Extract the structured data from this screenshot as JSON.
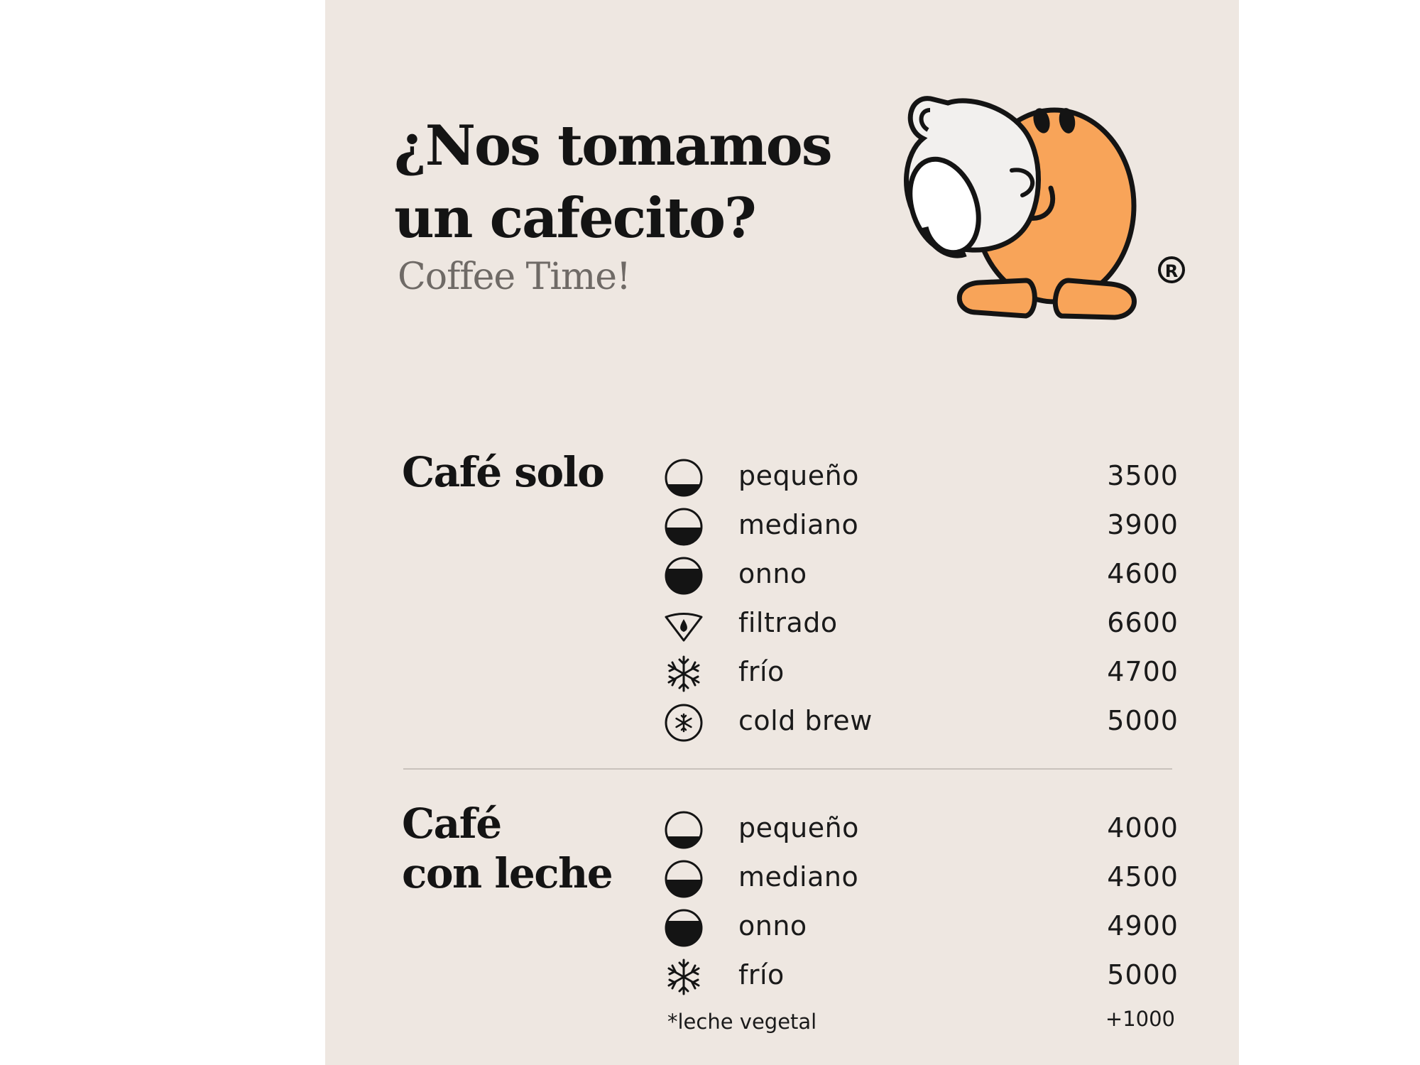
{
  "header": {
    "title_line1": "¿Nos tomamos",
    "title_line2": "un cafecito?",
    "subtitle": "Coffee Time!"
  },
  "mascot": {
    "icon": "mascot-holding-cup",
    "registered_mark": "®",
    "body_color": "#F8A459"
  },
  "colors": {
    "background": "#EEE7E1",
    "text": "#141414",
    "subtitle": "#6F6A66",
    "divider": "#C9C2BC"
  },
  "sections": [
    {
      "title_line1": "Café solo",
      "title_line2": "",
      "items": [
        {
          "icon": "cup-fill-small-icon",
          "name": "pequeño",
          "price": "3500"
        },
        {
          "icon": "cup-fill-medium-icon",
          "name": "mediano",
          "price": "3900"
        },
        {
          "icon": "cup-fill-large-icon",
          "name": "onno",
          "price": "4600"
        },
        {
          "icon": "filter-drop-icon",
          "name": "filtrado",
          "price": "6600"
        },
        {
          "icon": "snowflake-icon",
          "name": "frío",
          "price": "4700"
        },
        {
          "icon": "circled-snowflake-icon",
          "name": "cold brew",
          "price": "5000"
        }
      ]
    },
    {
      "title_line1": "Café",
      "title_line2": "con leche",
      "items": [
        {
          "icon": "cup-fill-small-icon",
          "name": "pequeño",
          "price": "4000"
        },
        {
          "icon": "cup-fill-medium-icon",
          "name": "mediano",
          "price": "4500"
        },
        {
          "icon": "cup-fill-large-icon",
          "name": "onno",
          "price": "4900"
        },
        {
          "icon": "snowflake-icon",
          "name": "frío",
          "price": "5000"
        }
      ],
      "note": "*leche vegetal",
      "note_price": "+1000"
    }
  ]
}
